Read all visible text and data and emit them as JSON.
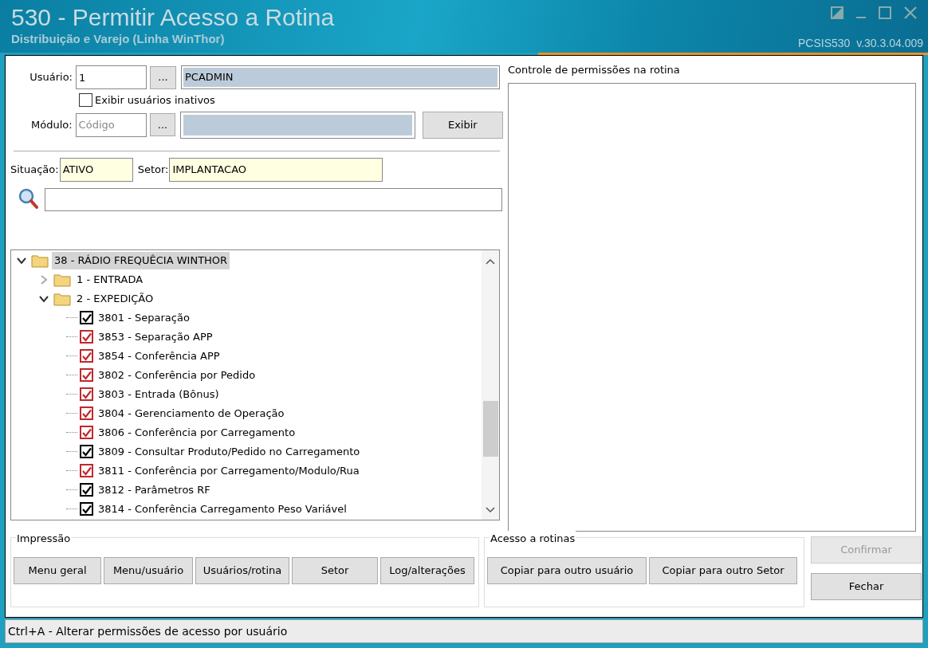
{
  "window": {
    "title": "530 - Permitir Acesso a Rotina",
    "subtitle": "Distribuição e Varejo (Linha WinThor)",
    "version": "PCSIS530  v.30.3.04.009"
  },
  "usuario": {
    "label": "Usuário:",
    "code": "1",
    "lookup": "...",
    "name": "PCADMIN"
  },
  "show_inactive": {
    "label": "Exibir usuários inativos",
    "checked": false
  },
  "modulo": {
    "label": "Módulo:",
    "placeholder": "Código",
    "lookup": "...",
    "button": "Exibir"
  },
  "situacao": {
    "label": "Situação:",
    "value": "ATIVO"
  },
  "setor": {
    "label": "Setor:",
    "value": "IMPLANTACAO"
  },
  "tree": [
    {
      "label": "38 - RÁDIO FREQUÊCIA WINTHOR",
      "expanded": true,
      "selected": true,
      "children": [
        {
          "label": "1 - ENTRADA",
          "expanded": false,
          "selected": false
        },
        {
          "label": "2 - EXPEDIÇÃO",
          "expanded": true,
          "selected": false,
          "children": [
            {
              "label": "3801 - Separação",
              "checked": true,
              "color": "#000000"
            },
            {
              "label": "3853 - Separação APP",
              "checked": true,
              "color": "#c0282d"
            },
            {
              "label": "3854 - Conferência APP",
              "checked": true,
              "color": "#c0282d"
            },
            {
              "label": "3802 - Conferência por Pedido",
              "checked": true,
              "color": "#c0282d"
            },
            {
              "label": "3803 - Entrada (Bônus)",
              "checked": true,
              "color": "#c0282d"
            },
            {
              "label": "3804 - Gerenciamento de Operação",
              "checked": true,
              "color": "#c0282d"
            },
            {
              "label": "3806 - Conferência por Carregamento",
              "checked": true,
              "color": "#c0282d"
            },
            {
              "label": "3809 - Consultar Produto/Pedido no Carregamento",
              "checked": true,
              "color": "#000000"
            },
            {
              "label": "3811 - Conferência por Carregamento/Modulo/Rua",
              "checked": true,
              "color": "#c0282d"
            },
            {
              "label": "3812 - Parâmetros RF",
              "checked": true,
              "color": "#000000"
            },
            {
              "label": "3814 - Conferência Carregamento Peso Variável",
              "checked": true,
              "color": "#000000"
            }
          ]
        }
      ]
    }
  ],
  "permissions_panel": {
    "title": "Controle de permissões na rotina"
  },
  "impressao": {
    "title": "Impressão",
    "buttons": [
      "Menu geral",
      "Menu/usuário",
      "Usuários/rotina",
      "Setor",
      "Log/alterações"
    ]
  },
  "acesso": {
    "title": "Acesso a rotinas",
    "buttons": [
      "Copiar para outro usuário",
      "Copiar para outro Setor"
    ]
  },
  "actions": [
    {
      "label": "Confirmar",
      "disabled": true
    },
    {
      "label": "Fechar",
      "disabled": false
    }
  ],
  "status_bar": "Ctrl+A - Alterar permissões de acesso por usuário"
}
